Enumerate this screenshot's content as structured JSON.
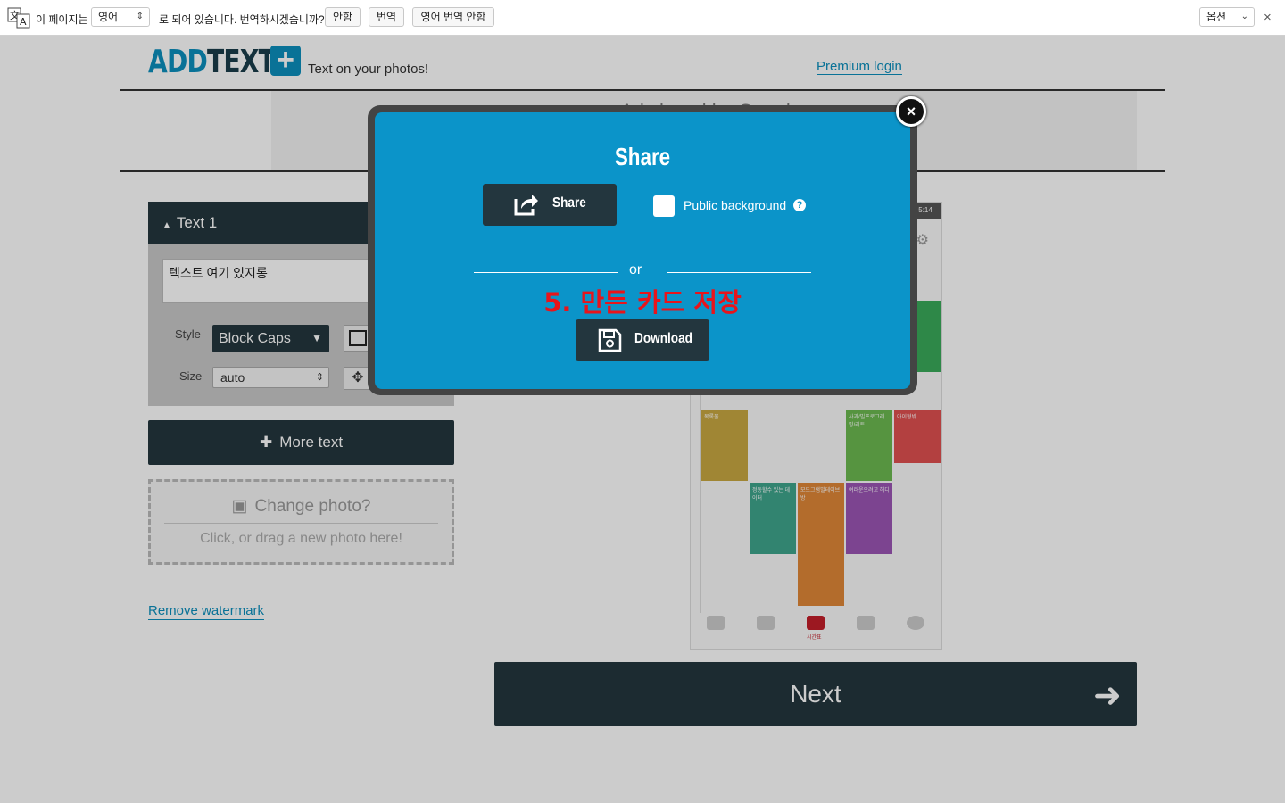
{
  "translate_bar": {
    "prefix": "이 페이지는",
    "language": "영어",
    "message": "로 되어 있습니다. 번역하시겠습니까?",
    "no_button": "안함",
    "translate_button": "번역",
    "never_button": "영어 번역 안함",
    "options": "옵션",
    "close": "×"
  },
  "header": {
    "logo_add": "ADD",
    "logo_text": "TEXT",
    "logo_plus": "+",
    "tagline": "Text on your photos!",
    "premium_login": "Premium login"
  },
  "ad": {
    "label": "Ad closed by Google"
  },
  "text_panel": {
    "title": "Text 1",
    "text_value": "텍스트 여기 있지롱",
    "style_label": "Style",
    "style_value": "Block Caps",
    "size_label": "Size",
    "size_value": "auto",
    "more_text": "More text",
    "change_photo": "Change photo?",
    "change_hint": "Click, or drag a new photo here!",
    "remove_watermark": "Remove watermark"
  },
  "preview": {
    "status_time": "5:14",
    "blocks": [
      {
        "label": "목록물",
        "color": "#c9a842"
      },
      {
        "label": "정동할수 있는 데이터",
        "color": "#3fa58c"
      },
      {
        "label": "모도그램빌테이브방",
        "color": "#e08838"
      },
      {
        "label": "여러운으려고 해디",
        "color": "#9b55b4"
      },
      {
        "label": "사과/빌프로그래밍/리트",
        "color": "#6cba50"
      },
      {
        "label": "아이형밖",
        "color": "#e05050"
      }
    ],
    "nav_active": "시간표"
  },
  "next_button": "Next",
  "modal": {
    "title": "Share",
    "share_button": "Share",
    "public_background": "Public background",
    "help": "?",
    "or": "or",
    "instruction": "5. 만든 카드 저장",
    "download_button": "Download",
    "close": "×"
  }
}
